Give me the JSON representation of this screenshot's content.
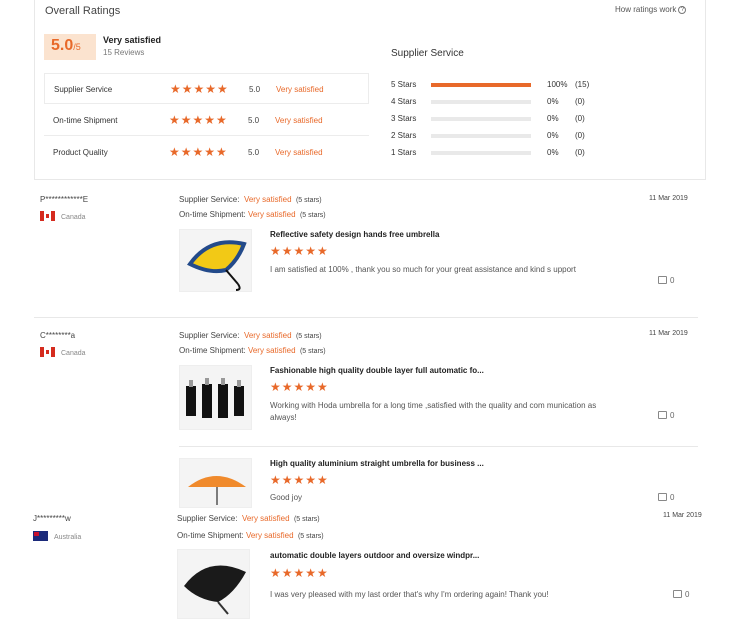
{
  "overall": {
    "title": "Overall Ratings",
    "how_link": "How ratings work",
    "score": "5.0",
    "score_suffix": "/5",
    "verdict": "Very satisfied",
    "reviews": "15 Reviews",
    "rows": [
      {
        "label": "Supplier Service",
        "stars": "★★★★★",
        "value": "5.0",
        "text": "Very satisfied"
      },
      {
        "label": "On-time Shipment",
        "stars": "★★★★★",
        "value": "5.0",
        "text": "Very satisfied"
      },
      {
        "label": "Product Quality",
        "stars": "★★★★★",
        "value": "5.0",
        "text": "Very satisfied"
      }
    ]
  },
  "supplier_service": {
    "title": "Supplier Service",
    "bars": [
      {
        "label": "5 Stars",
        "fill": 1.0,
        "pct": "100%",
        "count": "(15)"
      },
      {
        "label": "4 Stars",
        "fill": 0,
        "pct": "0%",
        "count": "(0)"
      },
      {
        "label": "3 Stars",
        "fill": 0,
        "pct": "0%",
        "count": "(0)"
      },
      {
        "label": "2 Stars",
        "fill": 0,
        "pct": "0%",
        "count": "(0)"
      },
      {
        "label": "1 Stars",
        "fill": 0,
        "pct": "0%",
        "count": "(0)"
      }
    ]
  },
  "reviews": [
    {
      "user": "P************E",
      "country": "Canada",
      "date": "11 Mar 2019",
      "service_label": "Supplier Service:",
      "service_value": "Very satisfied",
      "service_stars": "(5 stars)",
      "shipment_label": "On-time Shipment:",
      "shipment_value": "Very satisfied",
      "shipment_stars": "(5 stars)",
      "products": [
        {
          "title": "Reflective safety design hands free umbrella",
          "stars": "★★★★★",
          "comment": "I am satisfied at 100% , thank you so much for your great assistance and kind s upport",
          "likes": "0"
        }
      ]
    },
    {
      "user": "C********a",
      "country": "Canada",
      "date": "11 Mar 2019",
      "service_label": "Supplier Service:",
      "service_value": "Very satisfied",
      "service_stars": "(5 stars)",
      "shipment_label": "On-time Shipment:",
      "shipment_value": "Very satisfied",
      "shipment_stars": "(5 stars)",
      "products": [
        {
          "title": "Fashionable high quality double layer full automatic fo...",
          "stars": "★★★★★",
          "comment": "Working with Hoda umbrella for a long time ,satisfied with the quality and com munication as always!",
          "likes": "0"
        },
        {
          "title": "High quality aluminium straight umbrella for business ...",
          "stars": "★★★★★",
          "comment": "Good joy",
          "likes": "0"
        }
      ]
    },
    {
      "user": "J*********w",
      "country": "Australia",
      "date": "11 Mar 2019",
      "service_label": "Supplier Service:",
      "service_value": "Very satisfied",
      "service_stars": "(5 stars)",
      "shipment_label": "On-time Shipment:",
      "shipment_value": "Very satisfied",
      "shipment_stars": "(5 stars)",
      "products": [
        {
          "title": "automatic double layers outdoor and oversize windpr...",
          "stars": "★★★★★",
          "comment": "I was very pleased with my last order that's why I'm ordering again! Thank you!",
          "likes": "0"
        }
      ]
    }
  ]
}
